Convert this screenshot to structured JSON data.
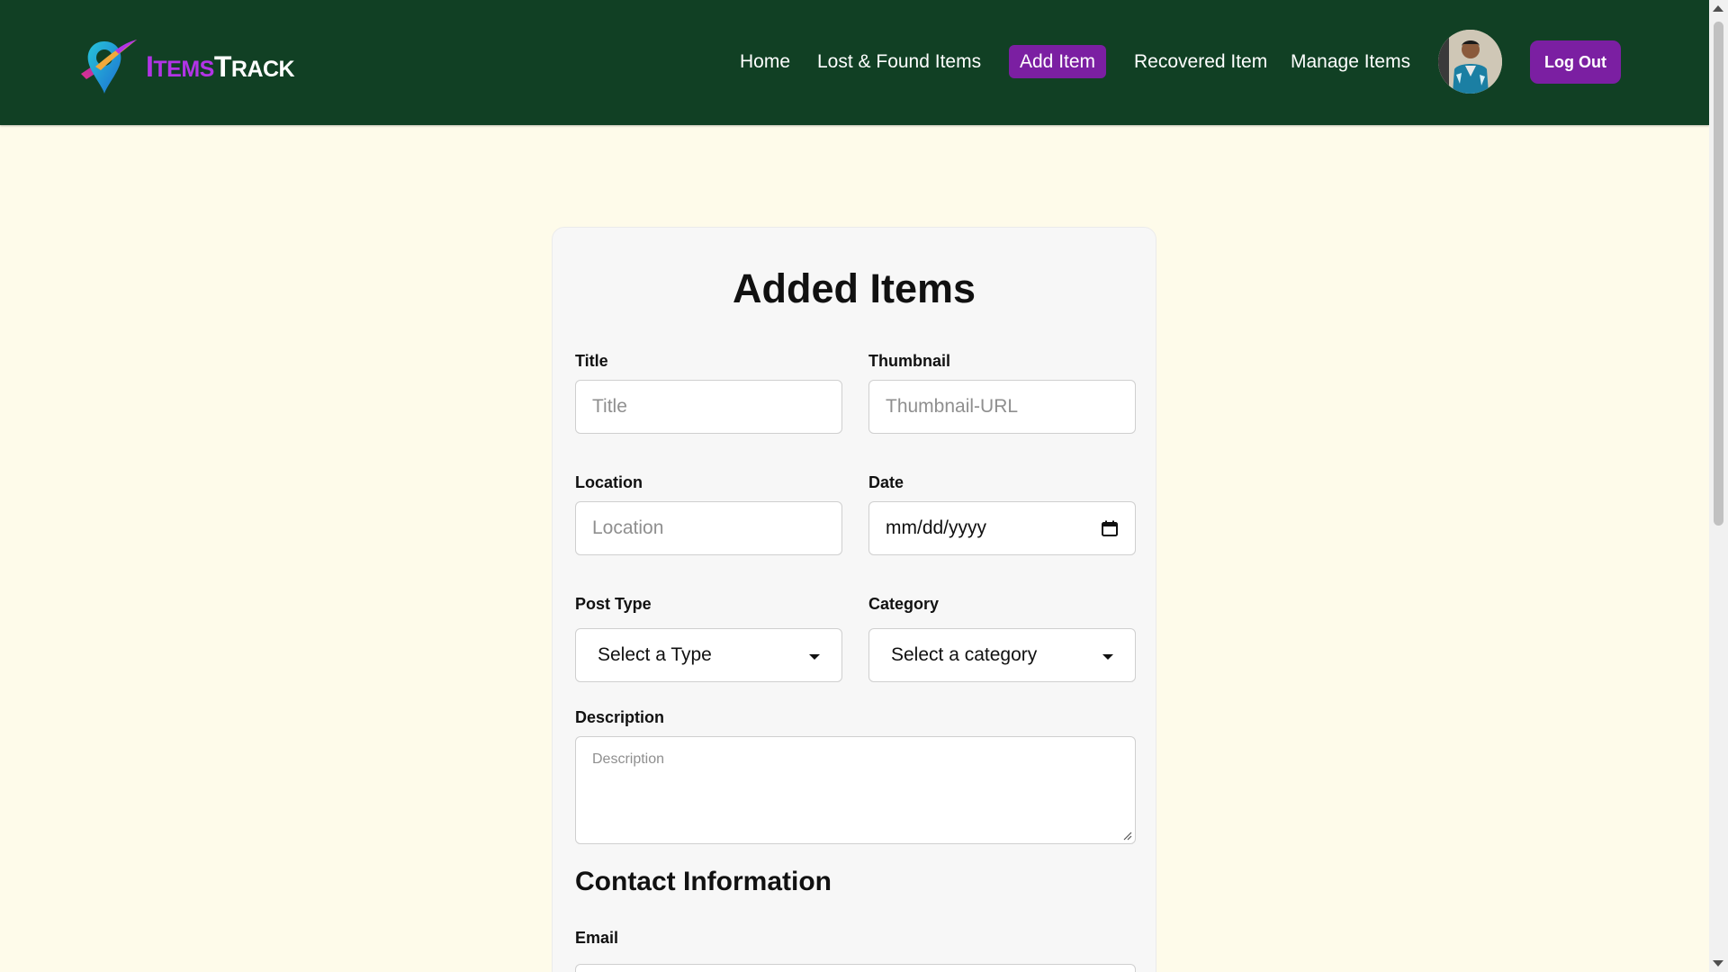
{
  "brand": {
    "name_part1_first": "I",
    "name_part1_rest": "TEMS",
    "name_part2_first": "T",
    "name_part2_rest": "RACK"
  },
  "nav": {
    "home": "Home",
    "lost_found": "Lost & Found Items",
    "add_item": "Add Item",
    "recovered": "Recovered Item",
    "manage": "Manage Items",
    "logout": "Log Out"
  },
  "form": {
    "heading": "Added Items",
    "title_label": "Title",
    "title_placeholder": "Title",
    "thumbnail_label": "Thumbnail",
    "thumbnail_placeholder": "Thumbnail-URL",
    "location_label": "Location",
    "location_placeholder": "Location",
    "date_label": "Date",
    "date_value": "mm/dd/yyyy",
    "post_type_label": "Post Type",
    "post_type_selected": "Select a Type",
    "category_label": "Category",
    "category_selected": "Select a category",
    "description_label": "Description",
    "description_placeholder": "Description",
    "contact_heading": "Contact Information",
    "email_label": "Email"
  },
  "colors": {
    "navbar_bg": "#114024",
    "accent": "#7b1fa2",
    "page_bg": "#fefbea",
    "brand_purple": "#b234e6"
  }
}
